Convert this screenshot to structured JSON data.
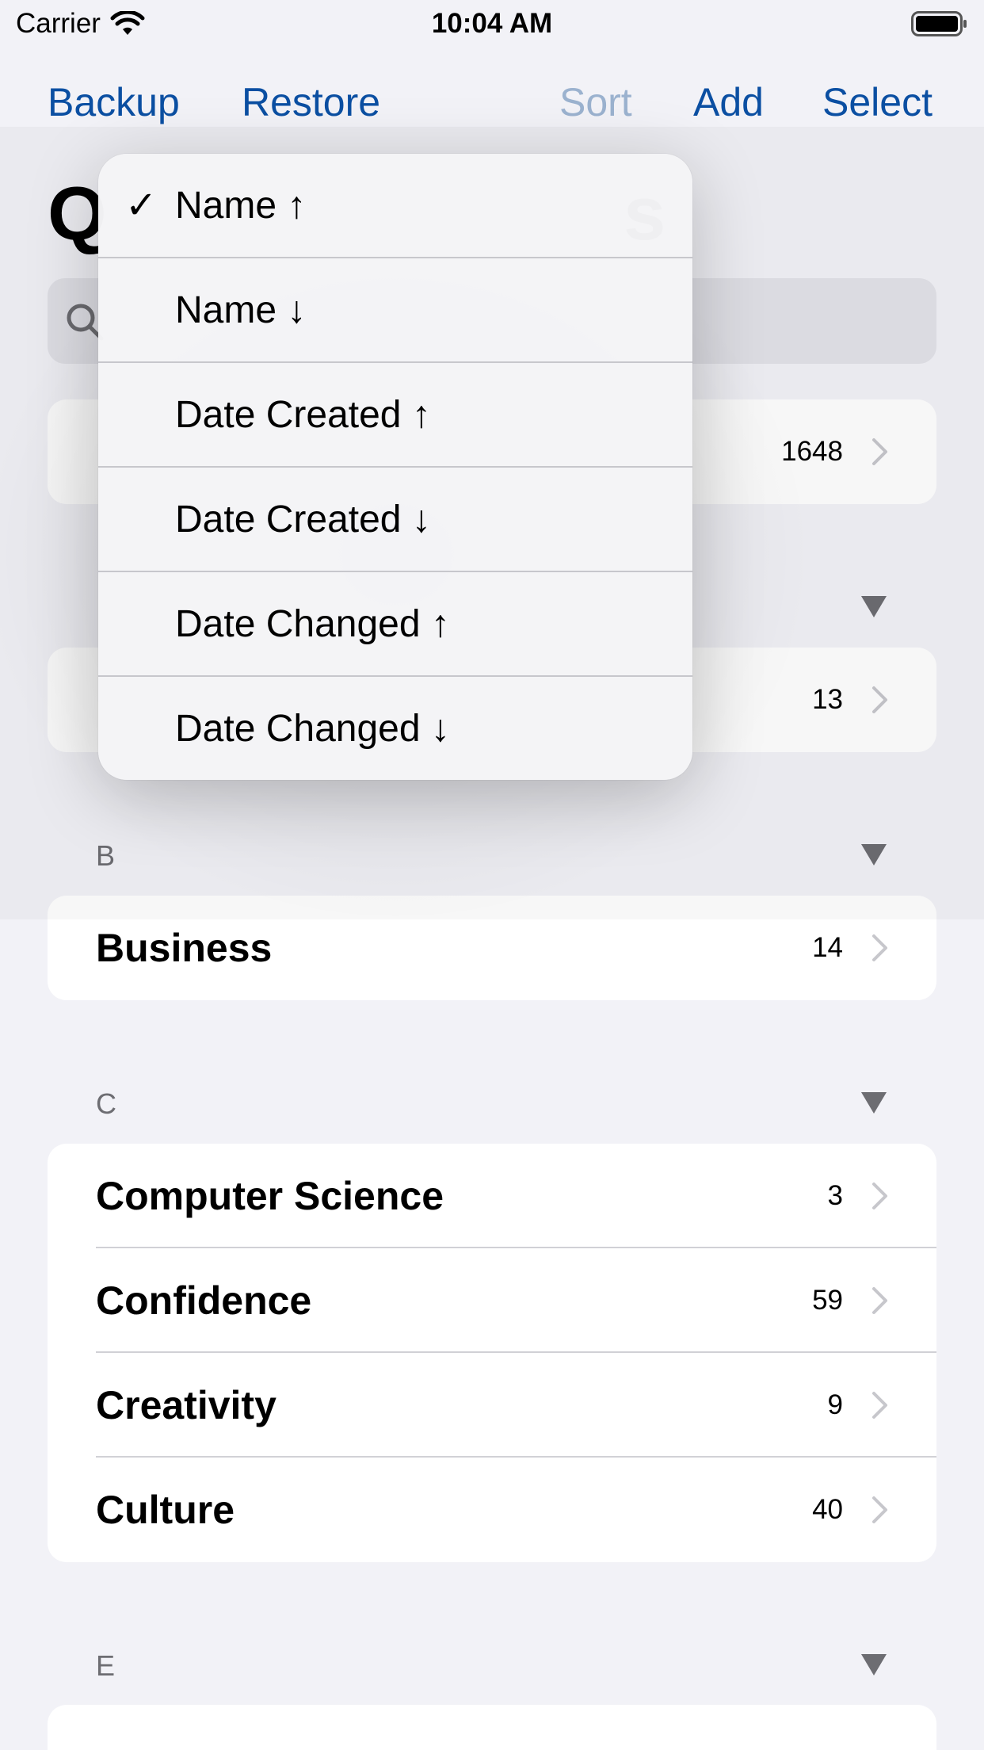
{
  "status": {
    "carrier": "Carrier",
    "time": "10:04 AM"
  },
  "nav": {
    "backup": "Backup",
    "restore": "Restore",
    "sort": "Sort",
    "add": "Add",
    "select": "Select"
  },
  "title": {
    "visible_left": "Q",
    "visible_right": "s"
  },
  "search": {
    "placeholder": ""
  },
  "all_row": {
    "count": "1648"
  },
  "sections": {
    "a": {
      "row_count": "13"
    },
    "b": {
      "letter": "B",
      "rows": [
        {
          "label": "Business",
          "count": "14"
        }
      ]
    },
    "c": {
      "letter": "C",
      "rows": [
        {
          "label": "Computer Science",
          "count": "3"
        },
        {
          "label": "Confidence",
          "count": "59"
        },
        {
          "label": "Creativity",
          "count": "9"
        },
        {
          "label": "Culture",
          "count": "40"
        }
      ]
    },
    "e": {
      "letter": "E"
    }
  },
  "sort_menu": {
    "items": [
      {
        "label": "Name ↑",
        "checked": "✓"
      },
      {
        "label": "Name ↓",
        "checked": ""
      },
      {
        "label": "Date Created ↑",
        "checked": ""
      },
      {
        "label": "Date Created ↓",
        "checked": ""
      },
      {
        "label": "Date Changed ↑",
        "checked": ""
      },
      {
        "label": "Date Changed ↓",
        "checked": ""
      }
    ]
  },
  "colors": {
    "accent": "#0b4fa2",
    "accent_disabled": "#9bb2cf",
    "background": "#f2f2f7",
    "secondary": "#6d6d72"
  },
  "icons": {
    "wifi": "wifi-icon",
    "battery": "battery-icon",
    "search": "search-icon",
    "chevron": "chevron-right-icon",
    "toggle": "triangle-down-icon"
  }
}
